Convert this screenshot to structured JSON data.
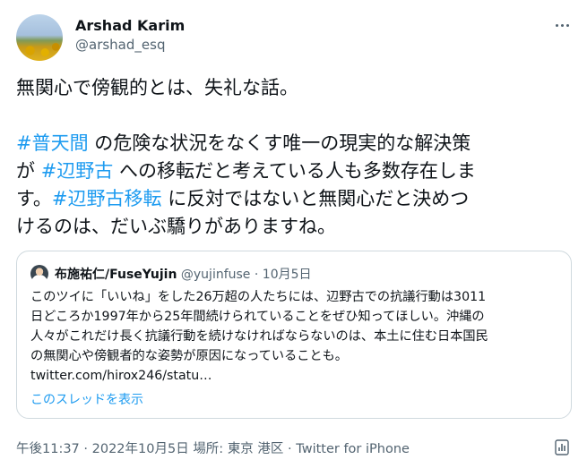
{
  "author": {
    "display_name": "Arshad Karim",
    "handle": "@arshad_esq"
  },
  "tweet": {
    "lines": [
      [
        {
          "t": "無関心で傍観的とは、失礼な話。"
        }
      ],
      [
        {
          "t": "#普天間",
          "tag": true
        },
        {
          "t": " の危険な状況をなくす唯一の現実的な解決策"
        }
      ],
      [
        {
          "t": "が "
        },
        {
          "t": "#辺野古",
          "tag": true
        },
        {
          "t": " への移転だと考えている人も多数存在しま"
        }
      ],
      [
        {
          "t": "す。"
        },
        {
          "t": "#辺野古移転",
          "tag": true
        },
        {
          "t": " に反対ではないと無関心だと決めつ"
        }
      ],
      [
        {
          "t": "けるのは、だいぶ驕りがありますね。"
        }
      ]
    ]
  },
  "quote": {
    "name": "布施祐仁/FuseYujin",
    "handle": "@yujinfuse",
    "separator": "·",
    "date": "10月5日",
    "body_lines": [
      "このツイに「いいね」をした26万超の人たちには、辺野古での抗議行動は3011",
      "日どころか1997年から25年間続けられていることをぜひ知ってほしい。沖縄の",
      "人々がこれだけ長く抗議行動を続けなければならないのは、本土に住む日本国民",
      "の無関心や傍観者的な姿勢が原因になっていることも。",
      "twitter.com/hirox246/statu…"
    ],
    "show_thread": "このスレッドを表示"
  },
  "footer": {
    "time_date": "午後11:37 · 2022年10月5日",
    "location_label": "場所:",
    "location": "東京 港区",
    "separator": "·",
    "source": "Twitter for iPhone"
  },
  "colors": {
    "link": "#1d9bf0",
    "text": "#0f1419",
    "muted": "#536471",
    "border": "#cfd9de"
  },
  "icons": [
    "more-icon",
    "analytics-icon"
  ]
}
